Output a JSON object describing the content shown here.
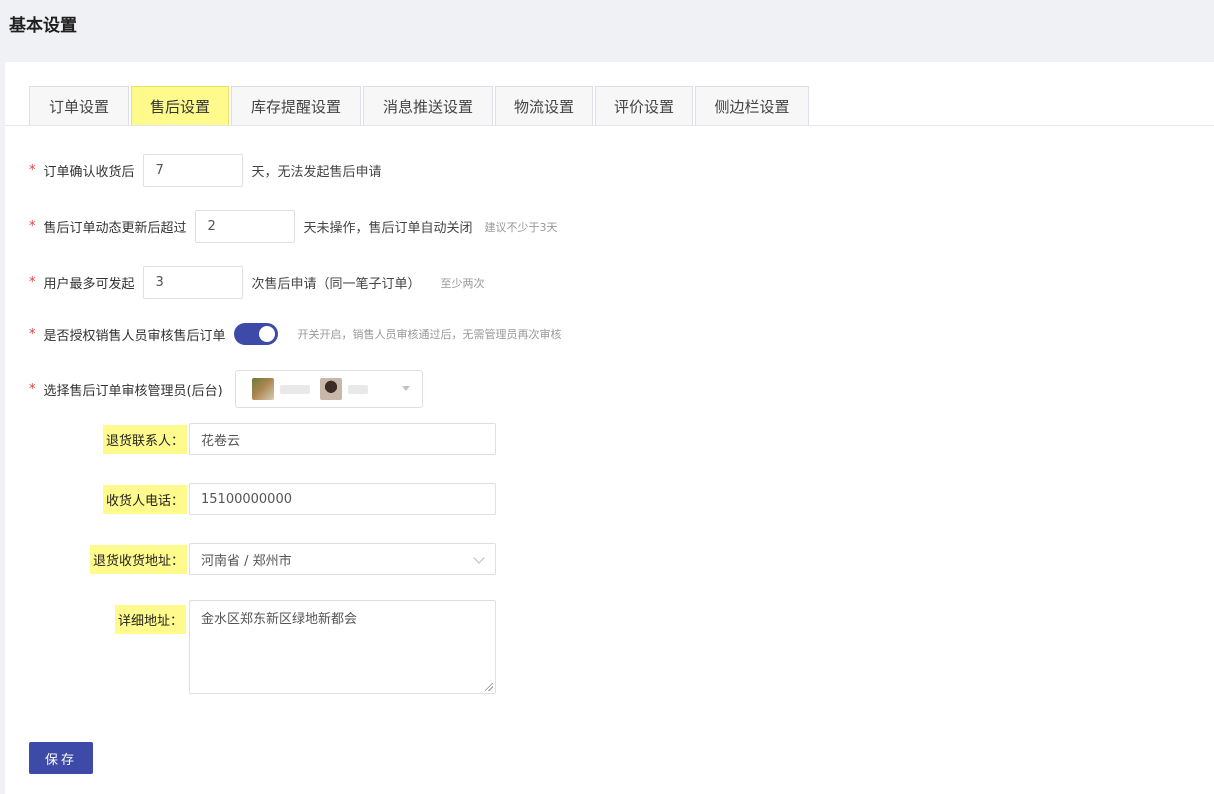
{
  "page": {
    "title": "基本设置"
  },
  "tabs": [
    {
      "label": "订单设置",
      "active": false
    },
    {
      "label": "售后设置",
      "active": true
    },
    {
      "label": "库存提醒设置",
      "active": false
    },
    {
      "label": "消息推送设置",
      "active": false
    },
    {
      "label": "物流设置",
      "active": false
    },
    {
      "label": "评价设置",
      "active": false
    },
    {
      "label": "侧边栏设置",
      "active": false
    }
  ],
  "form": {
    "required_mark": "*",
    "confirm_receipt": {
      "label": "订单确认收货后",
      "value": "7",
      "suffix": "天，无法发起售后申请"
    },
    "auto_close": {
      "label": "售后订单动态更新后超过",
      "value": "2",
      "suffix": "天未操作，售后订单自动关闭",
      "hint": "建议不少于3天"
    },
    "max_requests": {
      "label": "用户最多可发起",
      "value": "3",
      "suffix": "次售后申请（同一笔子订单）",
      "hint": "至少两次"
    },
    "authorize_sales": {
      "label": "是否授权销售人员审核售后订单",
      "enabled": true,
      "hint": "开关开启，销售人员审核通过后，无需管理员再次审核"
    },
    "manager_select": {
      "label": "选择售后订单审核管理员(后台)"
    },
    "return_contact": {
      "label": "退货联系人：",
      "value": "花卷云"
    },
    "receiver_phone": {
      "label": "收货人电话：",
      "value": "15100000000"
    },
    "return_address": {
      "label": "退货收货地址：",
      "value": "河南省 / 郑州市"
    },
    "detail_address": {
      "label": "详细地址：",
      "value": "金水区郑东新区绿地新都会"
    }
  },
  "actions": {
    "save_label": "保存"
  },
  "colors": {
    "primary": "#3e4aa7",
    "highlight": "#fffa8c",
    "required": "#e4393c"
  }
}
